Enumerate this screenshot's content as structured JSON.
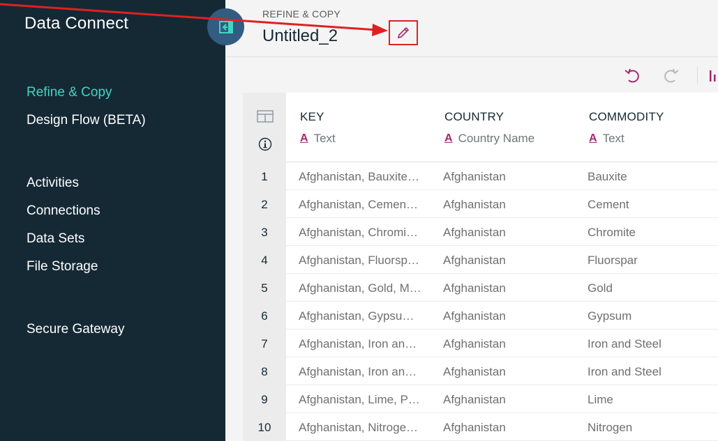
{
  "sidebar": {
    "app_title": "Data Connect",
    "items": [
      {
        "label": "Refine & Copy"
      },
      {
        "label": "Design Flow (BETA)"
      },
      {
        "label": "Activities"
      },
      {
        "label": "Connections"
      },
      {
        "label": "Data Sets"
      },
      {
        "label": "File Storage"
      },
      {
        "label": "Secure Gateway"
      }
    ]
  },
  "header": {
    "section": "REFINE & COPY",
    "title": "Untitled_2"
  },
  "table": {
    "columns": [
      {
        "name": "KEY",
        "type": "Text"
      },
      {
        "name": "COUNTRY",
        "type": "Country Name"
      },
      {
        "name": "COMMODITY",
        "type": "Text"
      }
    ],
    "rows": [
      {
        "num": "1",
        "key": "Afghanistan, Bauxite…",
        "country": "Afghanistan",
        "commodity": "Bauxite"
      },
      {
        "num": "2",
        "key": "Afghanistan, Cemen…",
        "country": "Afghanistan",
        "commodity": "Cement"
      },
      {
        "num": "3",
        "key": "Afghanistan, Chromi…",
        "country": "Afghanistan",
        "commodity": "Chromite"
      },
      {
        "num": "4",
        "key": "Afghanistan, Fluorsp…",
        "country": "Afghanistan",
        "commodity": "Fluorspar"
      },
      {
        "num": "5",
        "key": "Afghanistan, Gold, M…",
        "country": "Afghanistan",
        "commodity": "Gold"
      },
      {
        "num": "6",
        "key": "Afghanistan, Gypsu…",
        "country": "Afghanistan",
        "commodity": "Gypsum"
      },
      {
        "num": "7",
        "key": "Afghanistan, Iron an…",
        "country": "Afghanistan",
        "commodity": "Iron and Steel"
      },
      {
        "num": "8",
        "key": "Afghanistan, Iron an…",
        "country": "Afghanistan",
        "commodity": "Iron and Steel"
      },
      {
        "num": "9",
        "key": "Afghanistan, Lime, P…",
        "country": "Afghanistan",
        "commodity": "Lime"
      },
      {
        "num": "10",
        "key": "Afghanistan, Nitroge…",
        "country": "Afghanistan",
        "commodity": "Nitrogen"
      }
    ]
  },
  "icons": {
    "collapse": "collapse-sidebar-icon",
    "edit": "pencil-icon",
    "undo": "undo-icon",
    "redo": "redo-icon",
    "chart": "bar-chart-icon",
    "grid": "table-grid-icon",
    "info": "info-icon",
    "type": "text-type-icon"
  },
  "colors": {
    "sidebar_bg": "#152935",
    "active_nav": "#41d6c3",
    "accent": "#a6266e",
    "annotation": "#e02020"
  }
}
